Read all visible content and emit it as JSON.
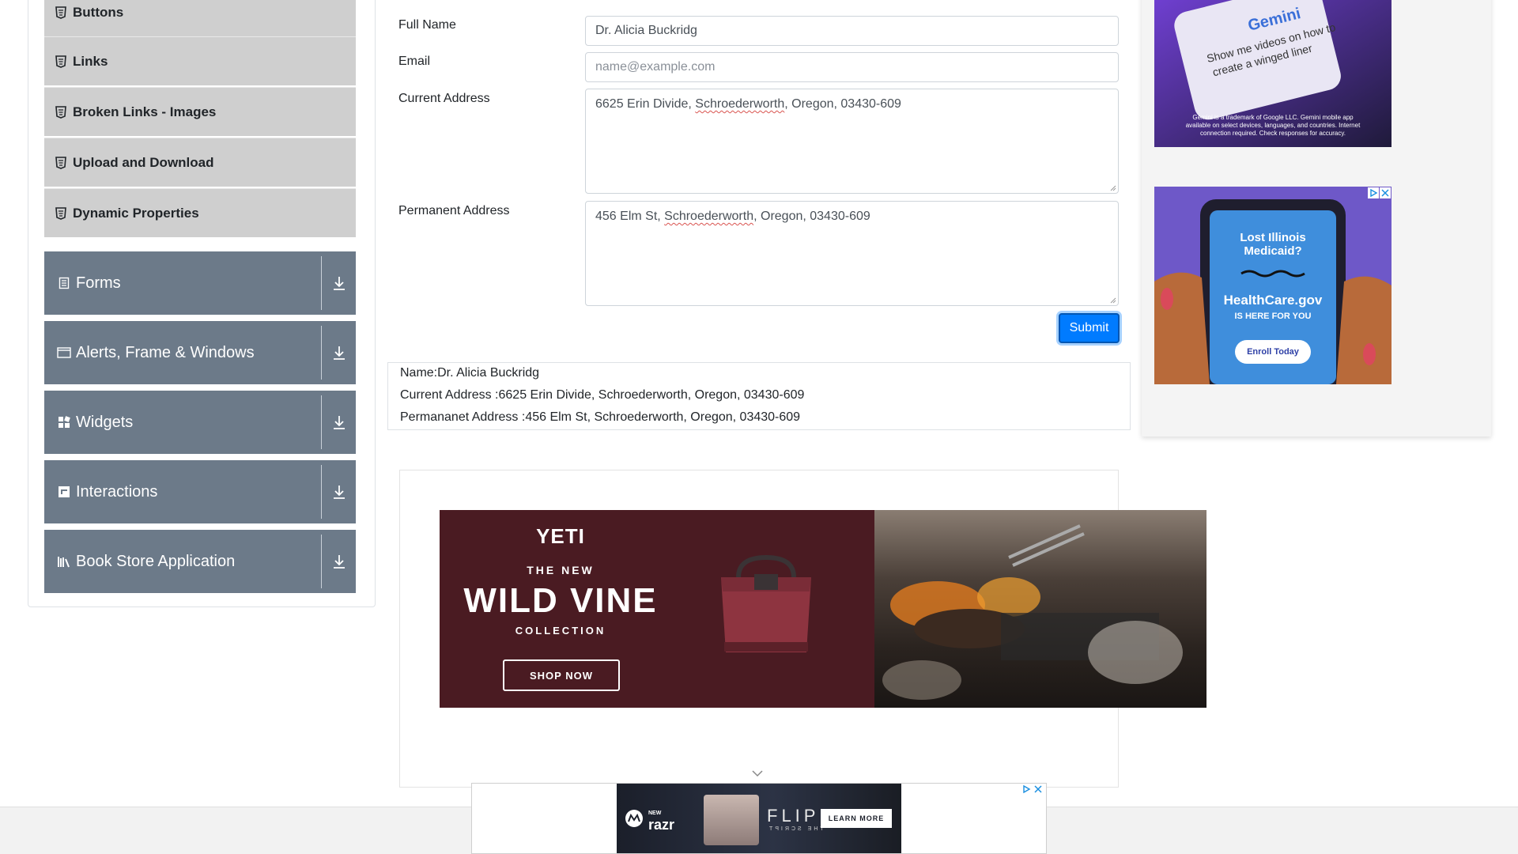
{
  "sidebar": {
    "sub_items": [
      {
        "label": "Buttons"
      },
      {
        "label": "Links"
      },
      {
        "label": "Broken Links - Images"
      },
      {
        "label": "Upload and Download"
      },
      {
        "label": "Dynamic Properties"
      }
    ],
    "groups": [
      {
        "label": "Forms",
        "icon": "form-icon"
      },
      {
        "label": "Alerts, Frame & Windows",
        "icon": "window-icon"
      },
      {
        "label": "Widgets",
        "icon": "widgets-icon"
      },
      {
        "label": "Interactions",
        "icon": "interactions-icon"
      },
      {
        "label": "Book Store Application",
        "icon": "book-icon"
      }
    ]
  },
  "form": {
    "full_name_label": "Full Name",
    "full_name_value": "Dr. Alicia Buckridg",
    "email_label": "Email",
    "email_placeholder": "name@example.com",
    "current_address_label": "Current Address",
    "current_address_pre": "6625 Erin Divide, ",
    "current_address_city": "Schroederworth",
    "current_address_post": ", Oregon, 03430-609",
    "permanent_address_label": "Permanent Address",
    "permanent_address_pre": "456 Elm St, ",
    "permanent_address_city": "Schroederworth",
    "permanent_address_post": ", Oregon, 03430-609",
    "submit_label": "Submit"
  },
  "output": {
    "name_line": "Name:Dr. Alicia Buckridg",
    "current_address_line": "Current Address :6625 Erin Divide, Schroederworth, Oregon, 03430-609",
    "permanent_address_line": "Permananet Address :456 Elm St, Schroederworth, Oregon, 03430-609"
  },
  "ads": {
    "yeti": {
      "brand": "YETI",
      "kicker": "THE NEW",
      "headline": "WILD VINE",
      "sub": "COLLECTION",
      "cta": "SHOP NOW"
    },
    "gemini": {
      "brand": "Gemini",
      "prompt_line1": "Show me videos on how to",
      "prompt_line2": "create a winged liner",
      "disclaimer_line1": "Gemini is a trademark of Google LLC. Gemini mobile app",
      "disclaimer_line2": "available on select devices, languages, and countries. Internet",
      "disclaimer_line3": "connection required. Check responses for accuracy."
    },
    "healthcare": {
      "headline_line1": "Lost Illinois",
      "headline_line2": "Medicaid?",
      "brand": "HealthCare.gov",
      "sub": "IS HERE FOR YOU",
      "cta": "Enroll Today"
    },
    "razr": {
      "badge": "NEW",
      "brand": "razr",
      "headline": "FLIP",
      "mirror": "THE SCRIPT",
      "cta": "LEARN MORE"
    }
  },
  "colors": {
    "sidebar_group_bg": "#6c7a89",
    "sidebar_sub_bg": "#cfcfcf",
    "primary": "#007bff"
  }
}
